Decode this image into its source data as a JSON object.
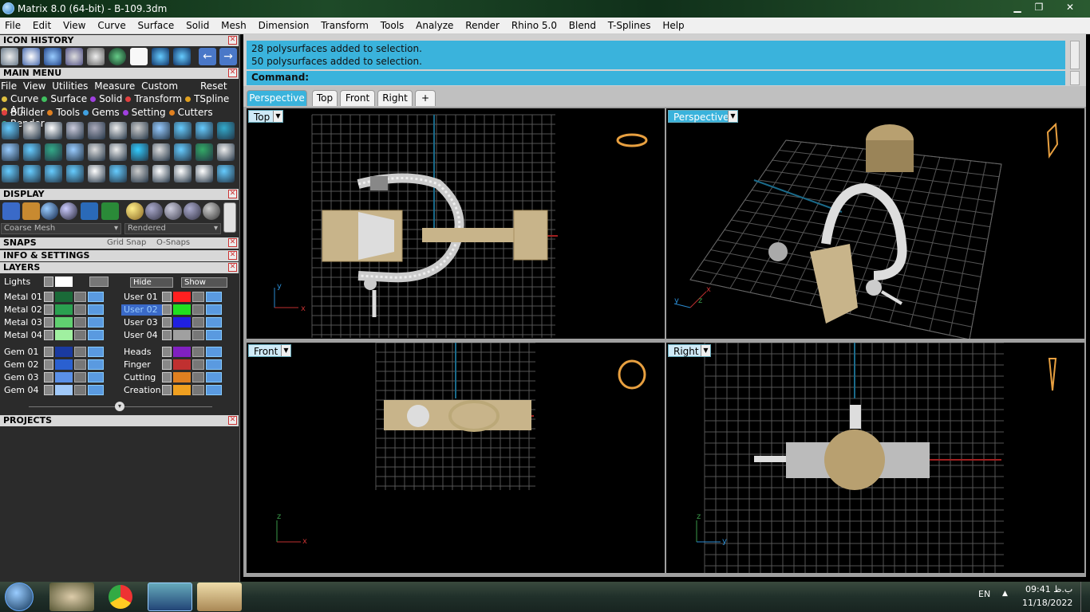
{
  "window": {
    "title": "Matrix 8.0 (64-bit) - B-109.3dm",
    "minimize_glyph": "▁",
    "maximize_glyph": "❐",
    "close_glyph": "✕"
  },
  "menubar": [
    "File",
    "Edit",
    "View",
    "Curve",
    "Surface",
    "Solid",
    "Mesh",
    "Dimension",
    "Transform",
    "Tools",
    "Analyze",
    "Render",
    "Rhino 5.0",
    "Blend",
    "T-Splines",
    "Help"
  ],
  "left_panel": {
    "icon_history": {
      "title": "ICON HISTORY"
    },
    "main_menu": {
      "title": "MAIN MENU",
      "menu_items": [
        "File",
        "View",
        "Utilities",
        "Measure",
        "Custom"
      ],
      "reset": "Reset",
      "row1": [
        {
          "label": "Curve",
          "color": "#e0c040"
        },
        {
          "label": "Surface",
          "color": "#40c060"
        },
        {
          "label": "Solid",
          "color": "#a040e0"
        },
        {
          "label": "Transform",
          "color": "#e04040"
        },
        {
          "label": "TSpline",
          "color": "#e0a020"
        },
        {
          "label": "Art",
          "color": "#e0c040"
        }
      ],
      "row2": [
        {
          "label": "Builder",
          "color": "#e04040"
        },
        {
          "label": "Tools",
          "color": "#e08020"
        },
        {
          "label": "Gems",
          "color": "#40a0e0"
        },
        {
          "label": "Setting",
          "color": "#a040e0"
        },
        {
          "label": "Cutters",
          "color": "#e08020"
        },
        {
          "label": "Render",
          "color": "#40c0a0"
        }
      ]
    },
    "display": {
      "title": "DISPLAY",
      "mesh_option": "Coarse Mesh",
      "render_option": "Rendered"
    },
    "snaps": {
      "title": "SNAPS",
      "grid_snap": "Grid Snap",
      "osnaps": "O-Snaps"
    },
    "info": {
      "title": "INFO & SETTINGS"
    },
    "layers": {
      "title": "LAYERS",
      "lights": "Lights",
      "hide": "Hide",
      "show": "Show",
      "left_col": [
        {
          "name": "Metal 01",
          "color": "#1a6a38"
        },
        {
          "name": "Metal 02",
          "color": "#2aa050"
        },
        {
          "name": "Metal 03",
          "color": "#60d070"
        },
        {
          "name": "Metal 04",
          "color": "#a0f0a0"
        },
        {
          "name": "Gem 01",
          "color": "#1a3aa0"
        },
        {
          "name": "Gem 02",
          "color": "#2a60d0"
        },
        {
          "name": "Gem 03",
          "color": "#5a90e8"
        },
        {
          "name": "Gem 04",
          "color": "#a0c8f8"
        }
      ],
      "right_col": [
        {
          "name": "User 01",
          "color": "#ff2020"
        },
        {
          "name": "User 02",
          "color": "#20e020"
        },
        {
          "name": "User 03",
          "color": "#2020e0"
        },
        {
          "name": "User 04",
          "color": "#a0a0a0"
        },
        {
          "name": "Heads",
          "color": "#8020c0"
        },
        {
          "name": "Finger",
          "color": "#c03030"
        },
        {
          "name": "Cutting",
          "color": "#e08020"
        },
        {
          "name": "Creation",
          "color": "#f0a020"
        }
      ]
    },
    "projects": {
      "title": "PROJECTS"
    }
  },
  "command": {
    "log": [
      "28 polysurfaces added to selection.",
      "50 polysurfaces added to selection."
    ],
    "prompt": "Command:"
  },
  "tabs": [
    {
      "label": "Perspective",
      "active": true
    },
    {
      "label": "Top",
      "active": false
    },
    {
      "label": "Front",
      "active": false
    },
    {
      "label": "Right",
      "active": false
    },
    {
      "label": "+",
      "active": false
    }
  ],
  "viewports": [
    {
      "name": "Top",
      "active": false,
      "axes": [
        "x",
        "y"
      ]
    },
    {
      "name": "Perspective",
      "active": true,
      "axes": [
        "x",
        "y",
        "z"
      ]
    },
    {
      "name": "Front",
      "active": false,
      "axes": [
        "x",
        "z"
      ]
    },
    {
      "name": "Right",
      "active": false,
      "axes": [
        "y",
        "z"
      ]
    }
  ],
  "taskbar": {
    "language": "EN",
    "time": "09:41 ب.ظ",
    "date": "11/18/2022"
  }
}
